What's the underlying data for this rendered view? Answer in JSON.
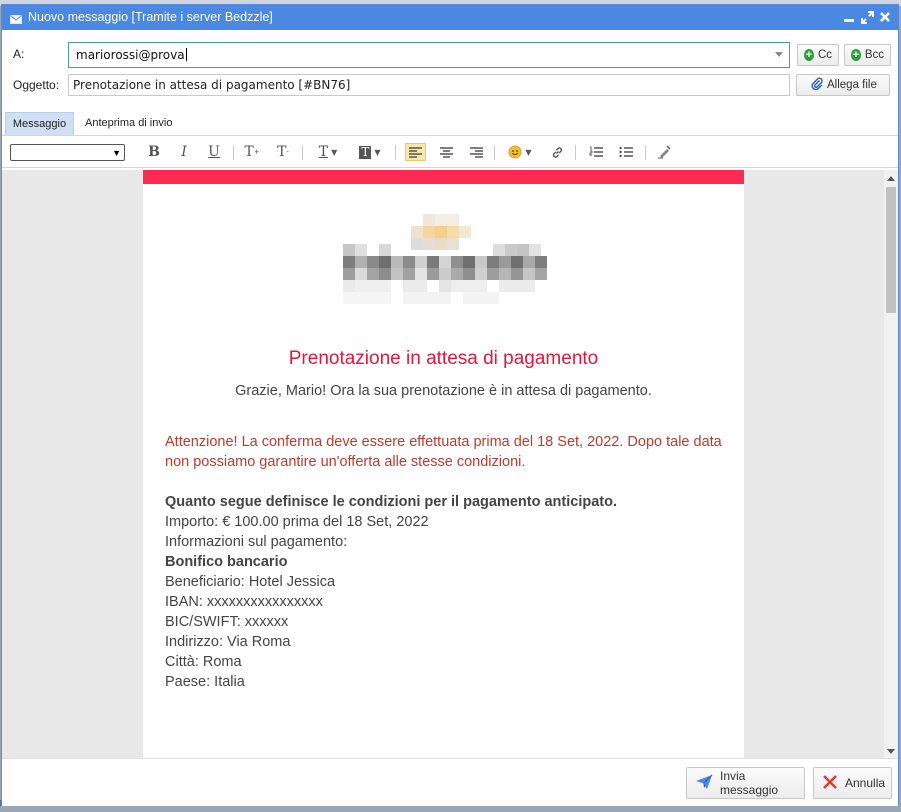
{
  "window": {
    "title": "Nuovo messaggio [Tramite i server Bedzzle]"
  },
  "compose": {
    "to_label": "A:",
    "to_value": "mariorossi@prova",
    "cc_label": "Cc",
    "bcc_label": "Bcc",
    "subject_label": "Oggetto:",
    "subject_value": "Prenotazione in attesa di pagamento [#BN76]",
    "attach_label": "Allega file"
  },
  "tabs": [
    {
      "label": "Messaggio",
      "active": true
    },
    {
      "label": "Anteprima di invio",
      "active": false
    }
  ],
  "toolbar": {
    "bold": "B",
    "italic": "I",
    "underline": "U",
    "superscript": "T",
    "subscript": "T",
    "text_color": "T",
    "bg_color": "T"
  },
  "email": {
    "accent_color": "#ff2a52",
    "title": "Prenotazione in attesa di pagamento",
    "subtitle": "Grazie, Mario! Ora la sua prenotazione è in attesa di pagamento.",
    "warning": "Attenzione! La conferma deve essere effettuata prima del 18 Set, 2022. Dopo tale data non possiamo garantire un'offerta alle stesse condizioni.",
    "conditions_heading": "Quanto segue definisce le condizioni per il pagamento anticipato.",
    "amount": "Importo: € 100.00 prima del 18 Set, 2022",
    "payment_info": "Informazioni sul pagamento:",
    "method": "Bonifico bancario",
    "beneficiary": "Beneficiario: Hotel Jessica",
    "iban": "IBAN: xxxxxxxxxxxxxxxx",
    "bic": "BIC/SWIFT: xxxxxx",
    "address": "Indirizzo: Via Roma",
    "city": "Città: Roma",
    "country": "Paese: Italia"
  },
  "footer": {
    "send_label": "Invia messaggio",
    "cancel_label": "Annulla"
  }
}
